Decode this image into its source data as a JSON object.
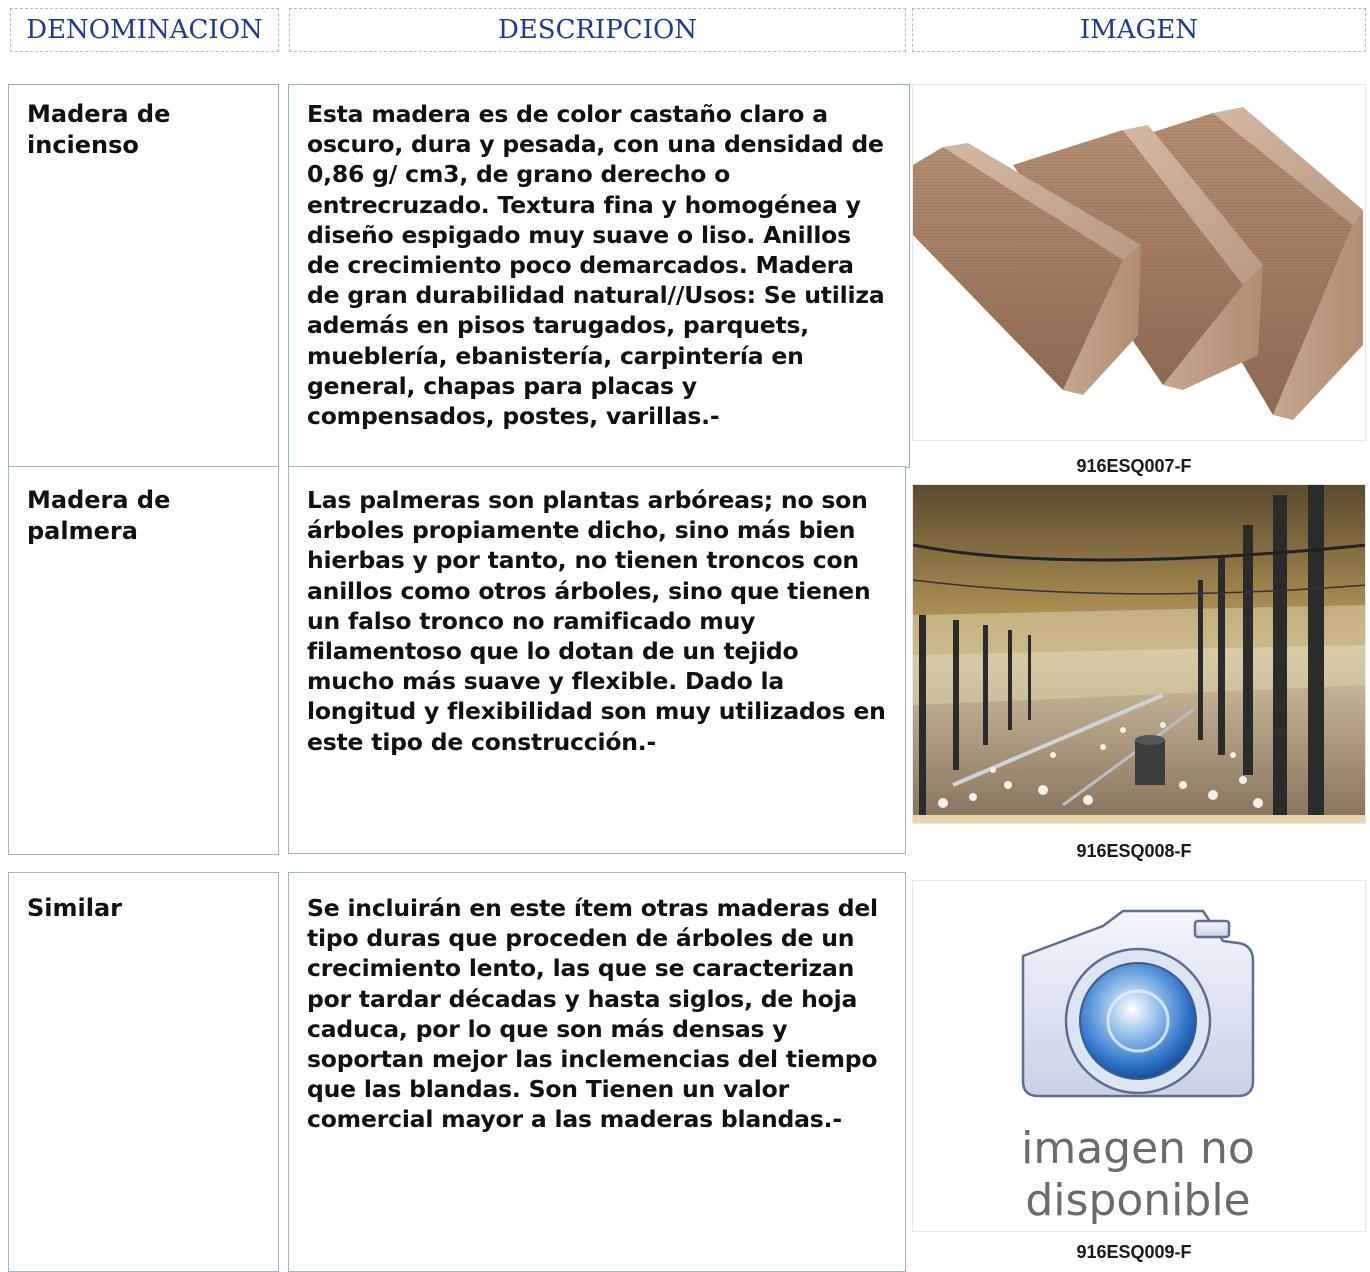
{
  "headers": {
    "denominacion": "DENOMINACION",
    "descripcion": "DESCRIPCION",
    "imagen": "IMAGEN"
  },
  "rows": [
    {
      "name": "Madera de incienso",
      "description": "Esta madera es de color castaño claro a oscuro, dura y pesada, con una densidad de 0,86 g/ cm3, de grano derecho o entrecruzado. Textura fina y homogénea y diseño espigado muy suave o liso. Anillos de crecimiento poco demarcados. Madera de gran durabilidad natural//Usos: Se utiliza además en pisos tarugados, parquets, mueblería, ebanistería, carpintería en general, chapas para placas y compensados, postes, varillas.-",
      "image_code": "916ESQ007-F",
      "image": "wood-blocks-photo"
    },
    {
      "name": "Madera de palmera",
      "description": "Las palmeras son plantas arbóreas; no son árboles propiamente dicho, sino más bien hierbas y por tanto, no tienen troncos con anillos como otros árboles, sino que tienen un falso tronco no ramificado muy filamentoso que lo dotan de un tejido mucho más suave y flexible. Dado la longitud y flexibilidad son muy utilizados en este tipo de construcción.-",
      "image_code": "916ESQ008-F",
      "image": "poultry-shed-photo"
    },
    {
      "name": "Similar",
      "description": "Se incluirán en este ítem otras maderas del tipo duras que proceden de árboles de un crecimiento lento, las que se caracterizan por tardar décadas y hasta siglos, de hoja caduca, por lo que son más densas y soportan mejor las inclemencias del tiempo que las blandas. Son Tienen un valor comercial mayor a las maderas blandas.-",
      "image_code": "916ESQ009-F",
      "image": "camera-placeholder",
      "placeholder_text_line1": "imagen no",
      "placeholder_text_line2": "disponible"
    }
  ]
}
